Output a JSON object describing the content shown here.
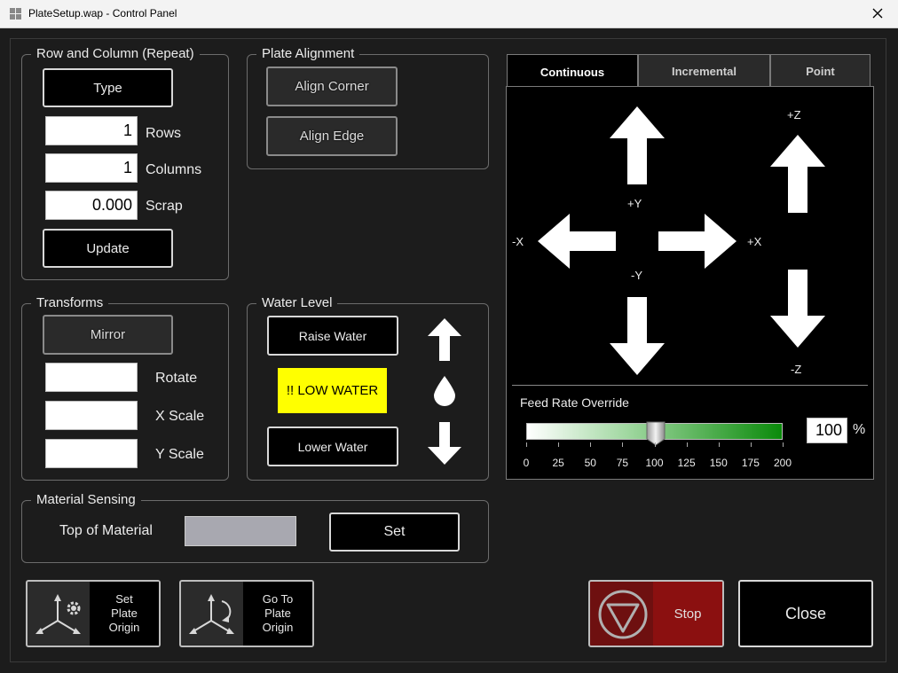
{
  "window": {
    "title": "PlateSetup.wap - Control Panel"
  },
  "row_column": {
    "label": "Row and Column (Repeat)",
    "type_button": "Type",
    "rows_value": "1",
    "rows_label": "Rows",
    "columns_value": "1",
    "columns_label": "Columns",
    "scrap_value": "0.000",
    "scrap_label": "Scrap",
    "update_button": "Update"
  },
  "plate_alignment": {
    "label": "Plate Alignment",
    "align_corner": "Align Corner",
    "align_edge": "Align Edge"
  },
  "transforms": {
    "label": "Transforms",
    "mirror": "Mirror",
    "rotate_value": "",
    "rotate_label": "Rotate",
    "xscale_value": "",
    "xscale_label": "X Scale",
    "yscale_value": "",
    "yscale_label": "Y Scale"
  },
  "water_level": {
    "label": "Water Level",
    "raise": "Raise Water",
    "status": "!! LOW WATER",
    "lower": "Lower Water",
    "status_color": "#ffff00"
  },
  "material_sensing": {
    "label": "Material Sensing",
    "top_label": "Top of Material",
    "set_button": "Set"
  },
  "jog": {
    "tabs": [
      "Continuous",
      "Incremental",
      "Point"
    ],
    "active_tab": "Continuous",
    "plus_y": "+Y",
    "minus_y": "-Y",
    "plus_x": "+X",
    "minus_x": "-X",
    "plus_z": "+Z",
    "minus_z": "-Z"
  },
  "feed_rate": {
    "label": "Feed Rate Override",
    "value": "100",
    "unit": "%",
    "slider_value": 100,
    "slider_min": 0,
    "slider_max": 200,
    "ticks": [
      "0",
      "25",
      "50",
      "75",
      "100",
      "125",
      "150",
      "175",
      "200"
    ]
  },
  "bottom": {
    "set_origin": "Set\nPlate\nOrigin",
    "goto_origin": "Go To\nPlate\nOrigin",
    "stop": "Stop",
    "close": "Close"
  },
  "colors": {
    "stop_red": "#8b1010",
    "slider_green": "#0a8a0a"
  }
}
